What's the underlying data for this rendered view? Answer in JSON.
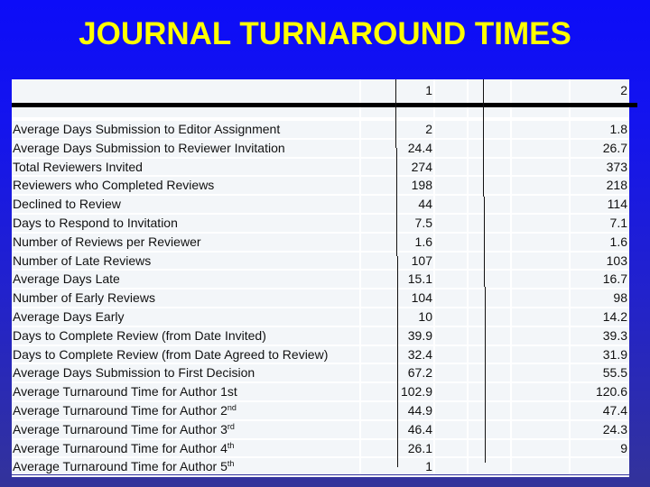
{
  "slide": {
    "title": "JOURNAL TURNAROUND TIMES",
    "colors": {
      "title": "#ffff00",
      "background_top": "#0c0cf8",
      "background_bottom": "#33339a",
      "table_bg": "#f3f6f9",
      "grid": "#ffffff"
    }
  },
  "table": {
    "header": {
      "label": "",
      "col1": "1",
      "col2": "2"
    },
    "rows": [
      {
        "label": "Average Days Submission to Editor Assignment",
        "sup": "",
        "col1": "2",
        "col2": "1.8"
      },
      {
        "label": "Average Days Submission to Reviewer Invitation",
        "sup": "",
        "col1": "24.4",
        "col2": "26.7"
      },
      {
        "label": "Total Reviewers Invited",
        "sup": "",
        "col1": "274",
        "col2": "373"
      },
      {
        "label": "Reviewers who Completed Reviews",
        "sup": "",
        "col1": "198",
        "col2": "218"
      },
      {
        "label": "Declined to Review",
        "sup": "",
        "col1": "44",
        "col2": "114"
      },
      {
        "label": "Days to Respond to Invitation",
        "sup": "",
        "col1": "7.5",
        "col2": "7.1"
      },
      {
        "label": "Number of Reviews per Reviewer",
        "sup": "",
        "col1": "1.6",
        "col2": "1.6"
      },
      {
        "label": "Number of Late Reviews",
        "sup": "",
        "col1": "107",
        "col2": "103"
      },
      {
        "label": "Average Days Late",
        "sup": "",
        "col1": "15.1",
        "col2": "16.7"
      },
      {
        "label": "Number of Early Reviews",
        "sup": "",
        "col1": "104",
        "col2": "98"
      },
      {
        "label": "Average Days Early",
        "sup": "",
        "col1": "10",
        "col2": "14.2"
      },
      {
        "label": "Days to Complete Review (from Date Invited)",
        "sup": "",
        "col1": "39.9",
        "col2": "39.3"
      },
      {
        "label": "Days to Complete Review (from Date Agreed to Review)",
        "sup": "",
        "col1": "32.4",
        "col2": "31.9"
      },
      {
        "label": "Average Days Submission to First Decision",
        "sup": "",
        "col1": "67.2",
        "col2": "55.5"
      },
      {
        "label": "Average Turnaround Time for Author 1st",
        "sup": "",
        "col1": "102.9",
        "col2": "120.6"
      },
      {
        "label": "Average Turnaround Time for Author 2",
        "sup": "nd",
        "col1": "44.9",
        "col2": "47.4"
      },
      {
        "label": "Average Turnaround Time for Author 3",
        "sup": "rd",
        "col1": "46.4",
        "col2": "24.3"
      },
      {
        "label": "Average Turnaround Time for Author 4",
        "sup": "th",
        "col1": "26.1",
        "col2": "9"
      },
      {
        "label": "Average Turnaround Time for Author 5",
        "sup": "th",
        "col1": "1",
        "col2": ""
      }
    ]
  }
}
